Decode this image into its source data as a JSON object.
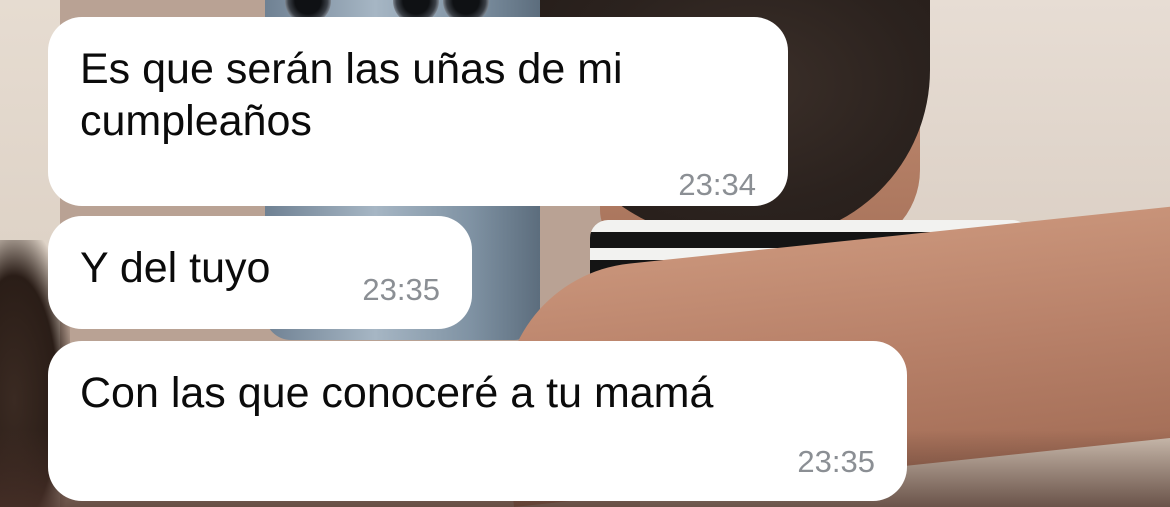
{
  "messages": [
    {
      "text": "Es que serán las uñas de mi\ncumpleaños",
      "time": "23:34"
    },
    {
      "text": "Y del tuyo",
      "time": "23:35"
    },
    {
      "text": "Con las que conoceré a tu mamá",
      "time": "23:35"
    }
  ],
  "wallpaper": {
    "description_icon": "photo-wallpaper-icon"
  }
}
